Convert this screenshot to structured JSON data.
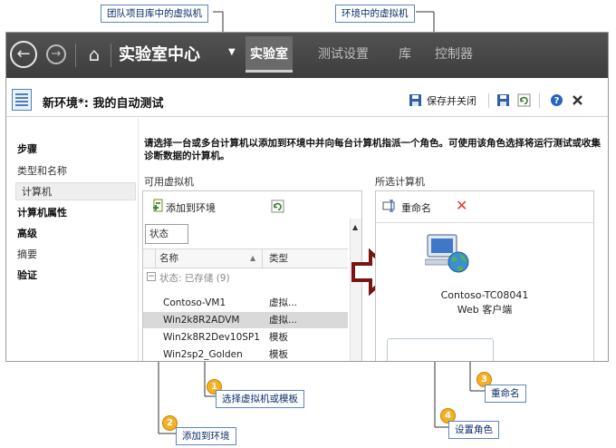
{
  "callouts": {
    "team_vm": "团队项目库中的虚拟机",
    "env_vm": "环境中的虚拟机",
    "c1": {
      "num": "1",
      "label": "选择虚拟机或模板"
    },
    "c2": {
      "num": "2",
      "label": "添加到环境"
    },
    "c3": {
      "num": "3",
      "label": "重命名"
    },
    "c4": {
      "num": "4",
      "label": "设置角色"
    }
  },
  "nav": {
    "title": "实验室中心",
    "tabs": [
      "实验室",
      "测试设置",
      "库",
      "控制器"
    ]
  },
  "titlebar": {
    "title": "新环境*: 我的自动测试",
    "save_close": "保存并关闭"
  },
  "steps": {
    "heading": "步骤",
    "items": [
      "类型和名称",
      "计算机",
      "计算机属性",
      "高级",
      "摘要",
      "验证"
    ]
  },
  "main": {
    "instructions": "请选择一台或多台计算机以添加到环境中并向每台计算机指派一个角色。可使用该角色选择将运行测试或收集诊断数据的计算机。",
    "available_label": "可用虚拟机",
    "selected_label": "所选计算机",
    "add_to_env": "添加到环境",
    "rename": "重命名",
    "group_box": "状态",
    "col_name": "名称",
    "col_type": "类型",
    "group_row": "状态: 已存储 (9)",
    "vms": [
      {
        "name": "Contoso-VM1",
        "type": "虚拟..."
      },
      {
        "name": "Win2k8R2ADVM",
        "type": "虚拟..."
      },
      {
        "name": "Win2k8R2Dev10SP1",
        "type": "模板"
      },
      {
        "name": "Win2sp2_Golden",
        "type": "模板"
      }
    ],
    "selected_machine": {
      "name": "Contoso-TC08041",
      "role": "Web 客户端"
    }
  },
  "colors": {
    "navbar": "#444444",
    "callout_border": "#5b86c4",
    "callout_number": "#f5b025",
    "selection": "#d9d9d9",
    "delete_x": "#e03a2f"
  }
}
